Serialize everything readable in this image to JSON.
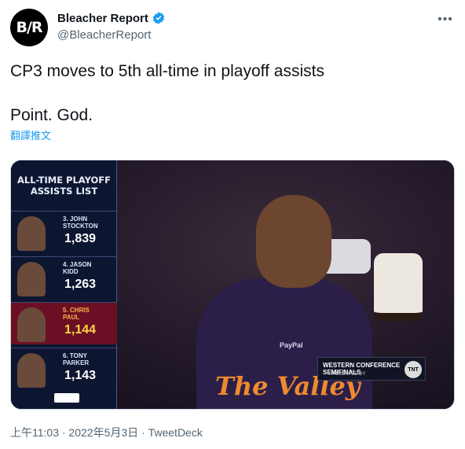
{
  "author": {
    "avatar_text": "B/R",
    "name": "Bleacher Report",
    "handle": "@BleacherReport",
    "verified_color": "#1d9bf0",
    "more_icon": "more-horizontal-icon"
  },
  "tweet": {
    "text": "CP3 moves to 5th all-time in playoff assists\n\nPoint. God.",
    "translate_label": "翻譯推文"
  },
  "media": {
    "panel_title": "ALL-TIME PLAYOFF\nASSISTS LIST",
    "rows": [
      {
        "name": "3. JOHN\nSTOCKTON",
        "value": "1,839",
        "highlight": false
      },
      {
        "name": "4. JASON\nKIDD",
        "value": "1,263",
        "highlight": false
      },
      {
        "name": "5. CHRIS\nPAUL",
        "value": "1,144",
        "highlight": true
      },
      {
        "name": "6. TONY\nPARKER",
        "value": "1,143",
        "highlight": false
      }
    ],
    "jersey_text": "The Valley",
    "sponsor": "PayPal",
    "broadcast_label": "WESTERN CONFERENCE SEMIFINALS",
    "broadcast_sub": "PRESENTED BY",
    "network": "TNT",
    "highlight_color": "#6b1024"
  },
  "meta": {
    "timestamp": "上午11:03 · 2022年5月3日 · TweetDeck"
  }
}
